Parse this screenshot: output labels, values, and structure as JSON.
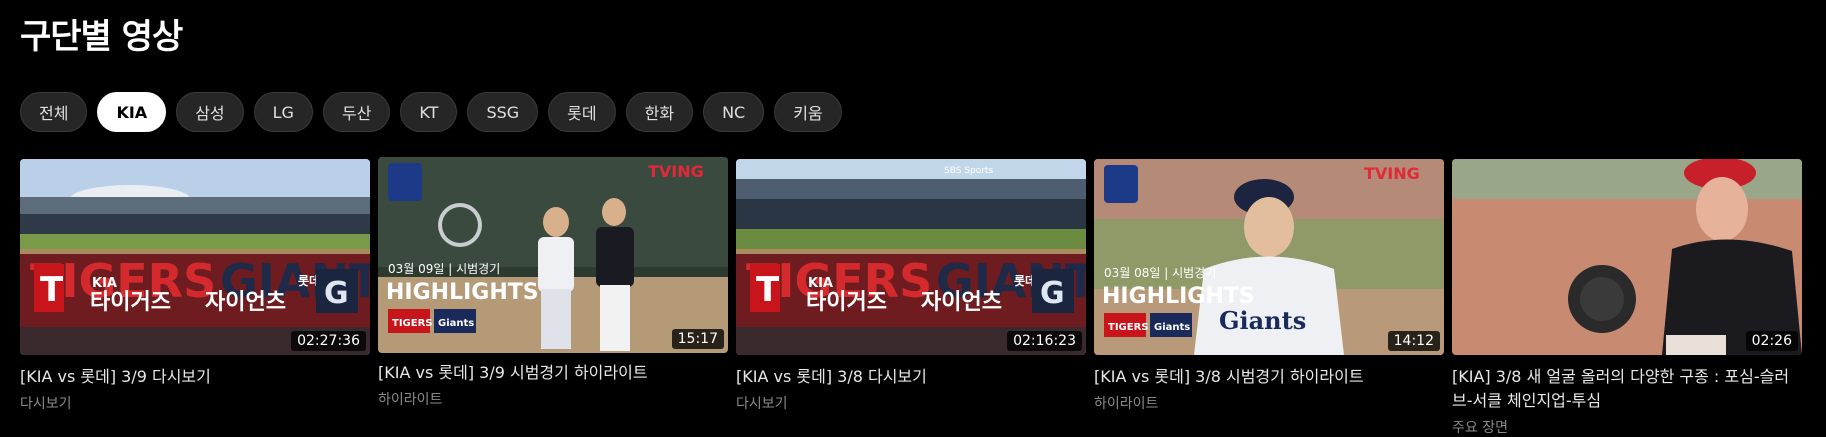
{
  "section": {
    "title": "구단별 영상"
  },
  "teams": [
    "전체",
    "KIA",
    "삼성",
    "LG",
    "두산",
    "KT",
    "SSG",
    "롯데",
    "한화",
    "NC",
    "키움"
  ],
  "selected_team": "KIA",
  "thumb_text": {
    "tigers_big": "TIGERS",
    "tigers_kia": "KIA",
    "tigers_kr": "타이거즈",
    "giants_big": "GIANTS",
    "giants_lotte": "롯데",
    "giants_kr": "자이언츠",
    "tving": "TVING",
    "highlights": "HIGHLIGHTS",
    "tigers_badge": "TIGERS",
    "giants_badge": "Giants",
    "sbs": "SBS Sports",
    "jersey_giants": "Giants"
  },
  "videos": [
    {
      "title": "[KIA vs 롯데] 3/9 다시보기",
      "category": "다시보기",
      "duration": "02:27:36",
      "date_line": ""
    },
    {
      "title": "[KIA vs 롯데] 3/9 시범경기 하이라이트",
      "category": "하이라이트",
      "duration": "15:17",
      "date_line": "03월 09일 | 시범경기"
    },
    {
      "title": "[KIA vs 롯데] 3/8 다시보기",
      "category": "다시보기",
      "duration": "02:16:23",
      "date_line": ""
    },
    {
      "title": "[KIA vs 롯데] 3/8 시범경기 하이라이트",
      "category": "하이라이트",
      "duration": "14:12",
      "date_line": "03월 08일 | 시범경기"
    },
    {
      "title": "[KIA] 3/8 새 얼굴 올러의 다양한 구종 : 포심-슬러브-서클 체인지업-투심",
      "category": "주요 장면",
      "duration": "02:26",
      "date_line": ""
    }
  ]
}
